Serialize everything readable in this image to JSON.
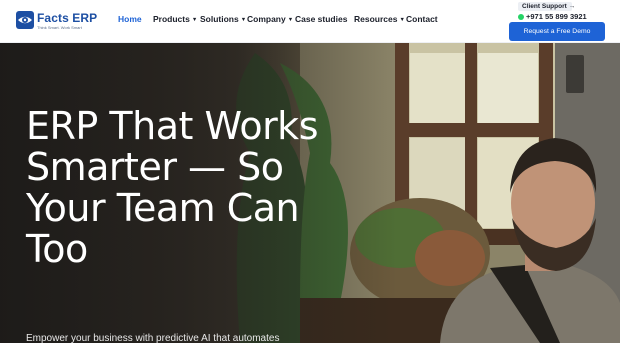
{
  "brand": {
    "name": "Facts ERP",
    "tagline": "Think Smart. Work Smart"
  },
  "nav": {
    "items": [
      {
        "label": "Home",
        "active": true
      },
      {
        "label": "Products",
        "dropdown": true
      },
      {
        "label": "Solutions",
        "dropdown": true
      },
      {
        "label": "Company",
        "dropdown": true
      },
      {
        "label": "Case studies"
      },
      {
        "label": "Resources",
        "dropdown": true
      },
      {
        "label": "Contact"
      }
    ]
  },
  "contact": {
    "support_label": "Client Support",
    "support_arrow": "→",
    "phone": "+971 55 899 3921"
  },
  "cta": {
    "demo_label": "Request a Free Demo"
  },
  "hero": {
    "title": "ERP That Works Smarter — So Your Team Can Too",
    "subtitle": "Empower your business with predictive AI that automates"
  },
  "colors": {
    "accent": "#1e63d6",
    "brand": "#1d4fa3",
    "nav_text": "#1b1f2a",
    "hero_text": "#ffffff"
  },
  "icons": {
    "logo": "eye-logo-icon",
    "caret": "chevron-down-icon",
    "phone": "whatsapp-icon"
  }
}
